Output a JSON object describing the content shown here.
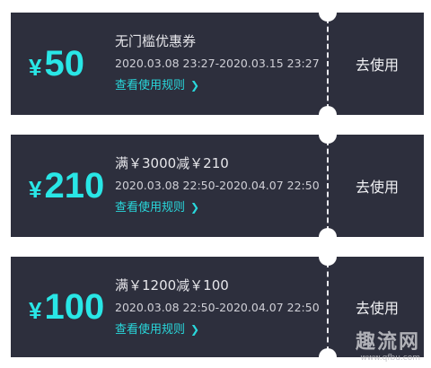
{
  "coupons": [
    {
      "currency": "¥",
      "amount": "50",
      "title": "无门槛优惠券",
      "validity": "2020.03.08 23:27-2020.03.15 23:27",
      "rules_link": "查看使用规则",
      "use_label": "去使用"
    },
    {
      "currency": "¥",
      "amount": "210",
      "title": "满￥3000减￥210",
      "validity": "2020.03.08 22:50-2020.04.07 22:50",
      "rules_link": "查看使用规则",
      "use_label": "去使用"
    },
    {
      "currency": "¥",
      "amount": "100",
      "title": "满￥1200减￥100",
      "validity": "2020.03.08 22:50-2020.04.07 22:50",
      "rules_link": "查看使用规则",
      "use_label": "去使用"
    }
  ],
  "watermark": {
    "title": "趣流网",
    "url": "www.qfbu.com"
  },
  "colors": {
    "card_background": "#2d2f3d",
    "amount_accent": "#29e6e6",
    "link_accent": "#29d8dc",
    "page_background": "#ffffff"
  },
  "icons": {
    "rules_chevron": "chevron-right-icon"
  }
}
